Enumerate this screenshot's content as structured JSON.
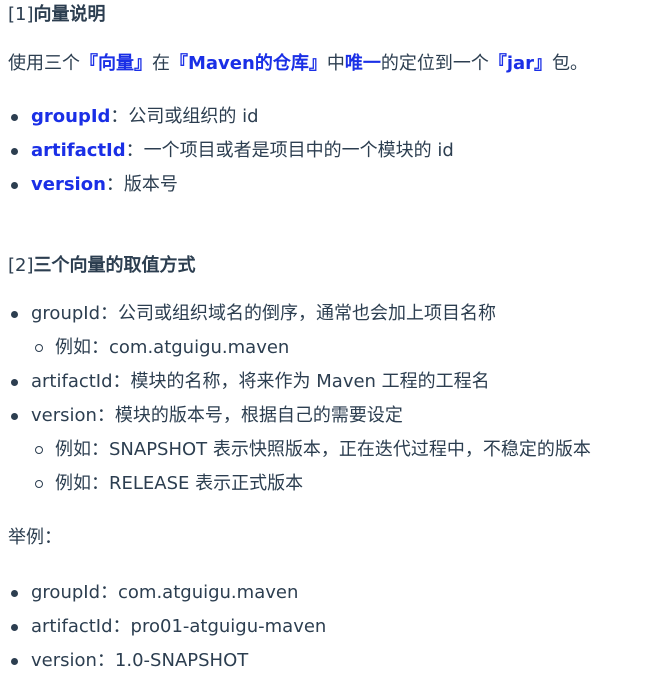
{
  "section1": {
    "heading_num": "[1]",
    "heading_text": "向量说明",
    "intro": {
      "p1": "使用三个",
      "b1": "『向量』",
      "p2": "在",
      "b2": "『Maven的仓库』",
      "p3": "中",
      "b3": "唯一",
      "p4": "的定位到一个",
      "b4": "『jar』",
      "p5": "包。"
    },
    "items": [
      {
        "key": "groupId",
        "desc": "：公司或组织的 id"
      },
      {
        "key": "artifactId",
        "desc": "：一个项目或者是项目中的一个模块的 id"
      },
      {
        "key": "version",
        "desc": "：版本号"
      }
    ]
  },
  "section2": {
    "heading_num": "[2]",
    "heading_text": "三个向量的取值方式",
    "items": [
      {
        "text": "groupId：公司或组织域名的倒序，通常也会加上项目名称"
      },
      {
        "text": "例如：com.atguigu.maven"
      },
      {
        "text": "artifactId：模块的名称，将来作为 Maven 工程的工程名"
      },
      {
        "text": "version：模块的版本号，根据自己的需要设定"
      },
      {
        "text": "例如：SNAPSHOT 表示快照版本，正在迭代过程中，不稳定的版本"
      },
      {
        "text": "例如：RELEASE 表示正式版本"
      }
    ]
  },
  "example": {
    "label": "举例：",
    "items": [
      {
        "text": "groupId：com.atguigu.maven"
      },
      {
        "text": "artifactId：pro01-atguigu-maven"
      },
      {
        "text": "version：1.0-SNAPSHOT"
      }
    ]
  }
}
